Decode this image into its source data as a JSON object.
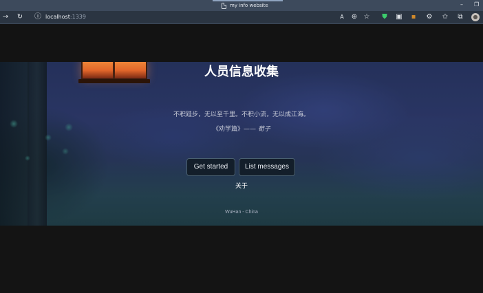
{
  "browser": {
    "tab_title": "my info website",
    "address_host": "localhost",
    "address_port": ":1339",
    "icons": [
      "forward-icon",
      "refresh-icon",
      "info-icon",
      "read-aloud-icon",
      "zoom-icon",
      "favorite-add-icon",
      "shield-extension-icon",
      "app-extension-icon",
      "extension-icon",
      "extensions-puzzle-icon",
      "favorites-icon",
      "collections-icon",
      "profile-icon"
    ]
  },
  "hero": {
    "title": "人员信息收集",
    "quote": "不积跬步，无以至千里。不积小流，无以成江海。",
    "cite_work": "《劝学篇》——",
    "cite_author": "荀子",
    "buttons": {
      "get_started": "Get started",
      "list_messages": "List messages"
    },
    "about_link": "关于",
    "location": "WuHan - China"
  },
  "colors": {
    "page_background": "#141414",
    "hero_tint": "#34427a",
    "button_border": "#4a6070"
  }
}
